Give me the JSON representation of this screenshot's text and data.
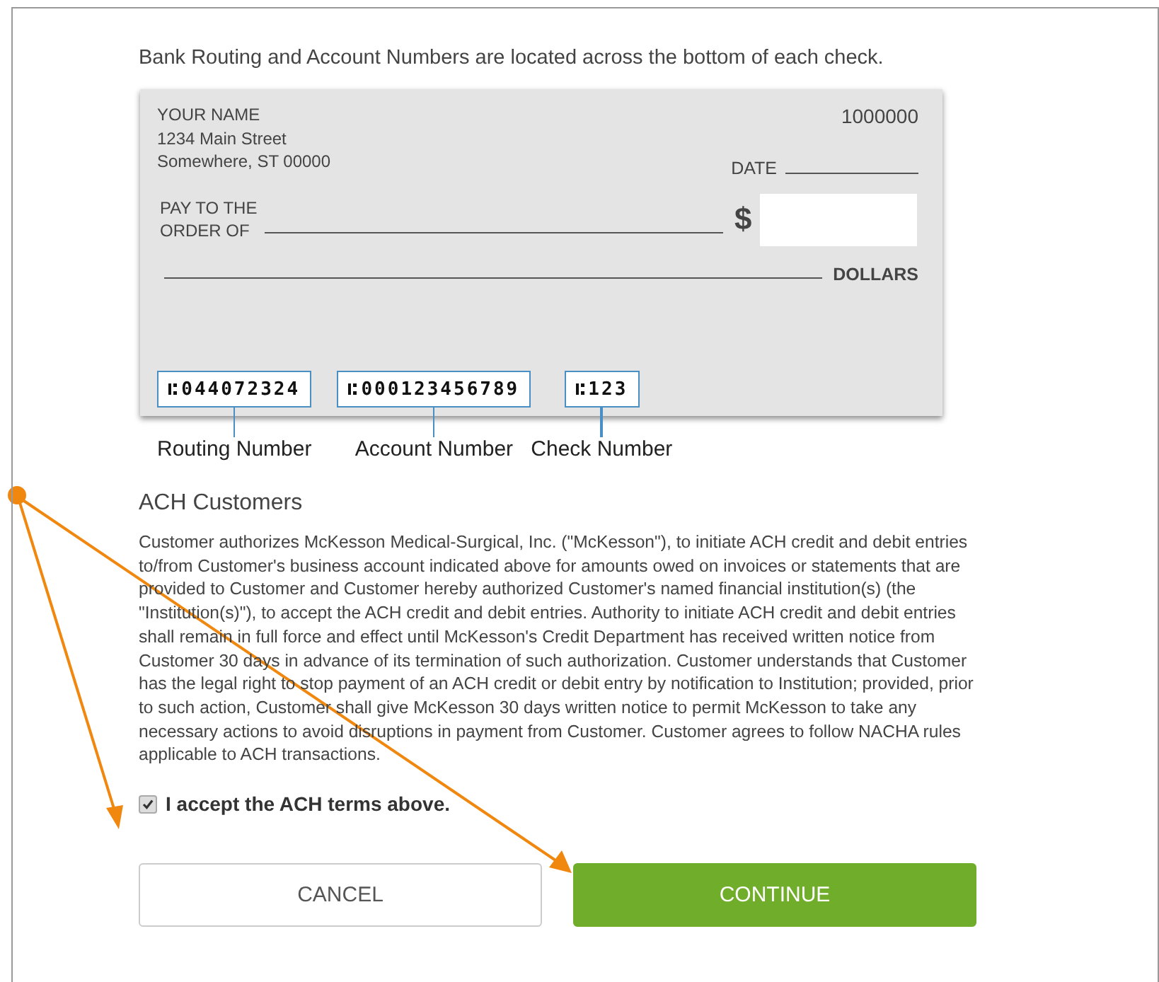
{
  "intro": "Bank Routing and Account Numbers are located across the bottom of each check.",
  "check": {
    "name": "YOUR NAME",
    "address_line_1": "1234 Main Street",
    "address_line_2": "Somewhere, ST 00000",
    "number": "1000000",
    "date_label": "DATE",
    "payee_label_1": "PAY TO THE",
    "payee_label_2": "ORDER OF",
    "currency_symbol": "$",
    "dollars_label": "DOLLARS",
    "micr": [
      {
        "value": "044072324",
        "caption": "Routing Number"
      },
      {
        "value": "000123456789",
        "caption": "Account Number"
      },
      {
        "value": "123",
        "caption": "Check Number"
      }
    ]
  },
  "section_title": "ACH Customers",
  "terms": "Customer authorizes McKesson Medical-Surgical, Inc. (\"McKesson\"), to initiate ACH credit and debit entries to/from Customer's business account indicated above for amounts owed on invoices or statements that are provided to Customer and Customer hereby authorized Customer's named financial institution(s) (the \"Institution(s)\"), to accept the ACH credit and debit entries. Authority to initiate ACH credit and debit entries shall remain in full force and effect until McKesson's Credit Department has received written notice from Customer 30 days in advance of its termination of such authorization. Customer understands that Customer has the legal right to stop payment of an ACH credit or debit entry by notification to Institution; provided, prior to such action, Customer shall give McKesson 30 days written notice to permit McKesson to take any necessary actions to avoid disruptions in payment from Customer. Customer agrees to follow NACHA rules applicable to ACH transactions.",
  "accept": {
    "label": "I accept the ACH terms above.",
    "checked": true
  },
  "buttons": [
    {
      "label": "CANCEL",
      "kind": "secondary"
    },
    {
      "label": "CONTINUE",
      "kind": "primary"
    }
  ]
}
